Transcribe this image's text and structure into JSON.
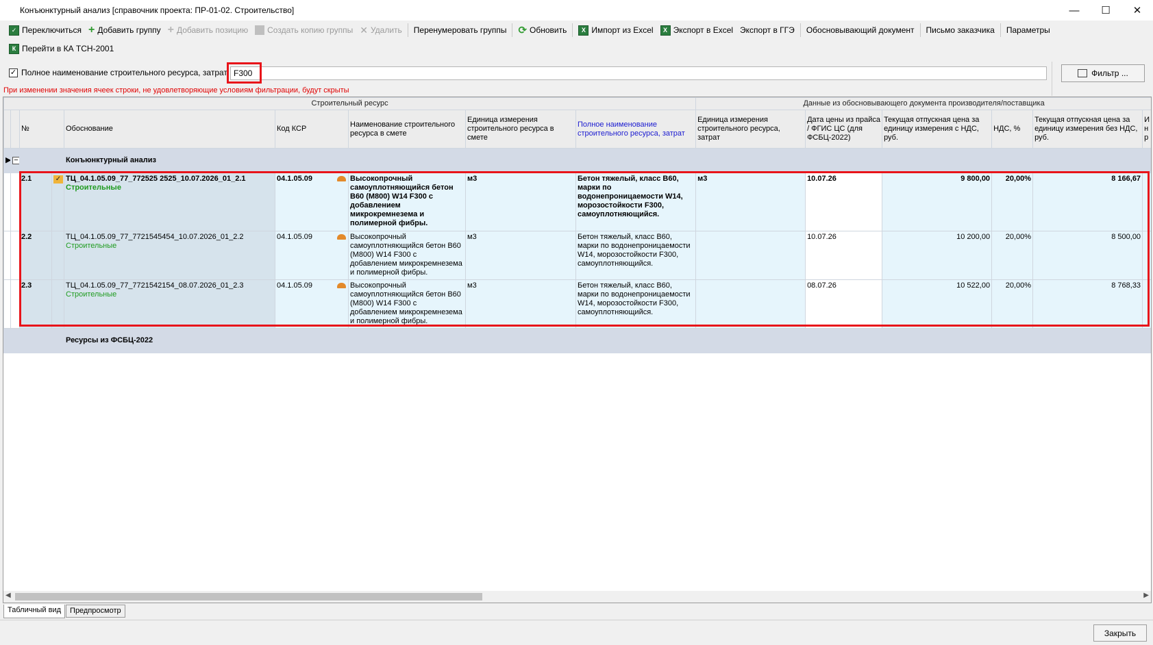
{
  "window": {
    "title": "Конъюнктурный анализ [справочник проекта: ПР-01-02. Строительство]",
    "minimize": "—",
    "maximize": "☐",
    "close": "✕"
  },
  "toolbar": {
    "switch": "Переключиться",
    "add_group": "Добавить группу",
    "add_position": "Добавить позицию",
    "copy_group": "Создать копию группы",
    "delete": "Удалить",
    "renumber": "Перенумеровать группы",
    "refresh": "Обновить",
    "import_excel": "Импорт из Excel",
    "export_excel": "Экспорт в Excel",
    "export_gge": "Экспорт в ГГЭ",
    "doc": "Обосновывающий документ",
    "letter": "Письмо заказчика",
    "params": "Параметры",
    "goto_tsn": "Перейти в КА ТСН-2001"
  },
  "filter": {
    "checkbox_label": "Полное наименование строительного ресурса, затрат",
    "value": "F300",
    "button": "Фильтр ...",
    "warning": "При изменении значения ячеек строки, не удовлетворяющие условиям фильтрации, будут скрыты"
  },
  "table": {
    "group_left": "Строительный ресурс",
    "group_right": "Данные из обосновывающего документа производителя/поставщика",
    "headers": {
      "num": "№",
      "basis": "Обоснование",
      "ksr": "Код КСР",
      "name_est": "Наименование строительного ресурса в смете",
      "unit_est": "Единица измерения строительного ресурса в смете",
      "full_name": "Полное наименование строительного ресурса, затрат",
      "unit": "Единица измерения строительного ресурса, затрат",
      "date": "Дата цены из прайса / ФГИС ЦС (для ФСБЦ-2022)",
      "price_vat": "Текущая отпускная цена за единицу измерения с НДС, руб.",
      "vat": "НДС, %",
      "price_novat": "Текущая отпускная цена за единицу измерения без НДС, руб.",
      "extra": "И н р"
    },
    "section1": "Конъюнктурный анализ",
    "section2": "Ресурсы из ФСБЦ-2022",
    "expander": "−",
    "rows": [
      {
        "num": "2.1",
        "basis": "ТЦ_04.1.05.09_77_772525 2525_10.07.2026_01_2.1",
        "category": "Строительные",
        "ksr": "04.1.05.09",
        "name_est": "Высокопрочный самоуплотняющийся бетон B60 (M800) W14 F300 с добавлением микрокремнезема и полимерной фибры.",
        "unit_est": "м3",
        "full_name": "Бетон тяжелый, класс B60, марки по водонепроницаемости W14, морозостойкости F300, самоуплотняющийся.",
        "unit": "м3",
        "date": "10.07.26",
        "price_vat": "9 800,00",
        "vat": "20,00%",
        "price_novat": "8 166,67"
      },
      {
        "num": "2.2",
        "basis": "ТЦ_04.1.05.09_77_7721545454_10.07.2026_01_2.2",
        "category": "Строительные",
        "ksr": "04.1.05.09",
        "name_est": "Высокопрочный самоуплотняющийся бетон B60 (M800) W14 F300 с добавлением микрокремнезема и полимерной фибры.",
        "unit_est": "м3",
        "full_name": "Бетон тяжелый, класс B60, марки по водонепроницаемости W14, морозостойкости F300, самоуплотняющийся.",
        "unit": "",
        "date": "10.07.26",
        "price_vat": "10 200,00",
        "vat": "20,00%",
        "price_novat": "8 500,00"
      },
      {
        "num": "2.3",
        "basis": "ТЦ_04.1.05.09_77_7721542154_08.07.2026_01_2.3",
        "category": "Строительные",
        "ksr": "04.1.05.09",
        "name_est": "Высокопрочный самоуплотняющийся бетон B60 (M800) W14 F300 с добавлением микрокремнезема и полимерной фибры.",
        "unit_est": "м3",
        "full_name": "Бетон тяжелый, класс B60, марки по водонепроницаемости W14, морозостойкости F300, самоуплотняющийся.",
        "unit": "",
        "date": "08.07.26",
        "price_vat": "10 522,00",
        "vat": "20,00%",
        "price_novat": "8 768,33"
      }
    ]
  },
  "tabs": {
    "table": "Табличный вид",
    "preview": "Предпросмотр"
  },
  "footer": {
    "close": "Закрыть"
  }
}
